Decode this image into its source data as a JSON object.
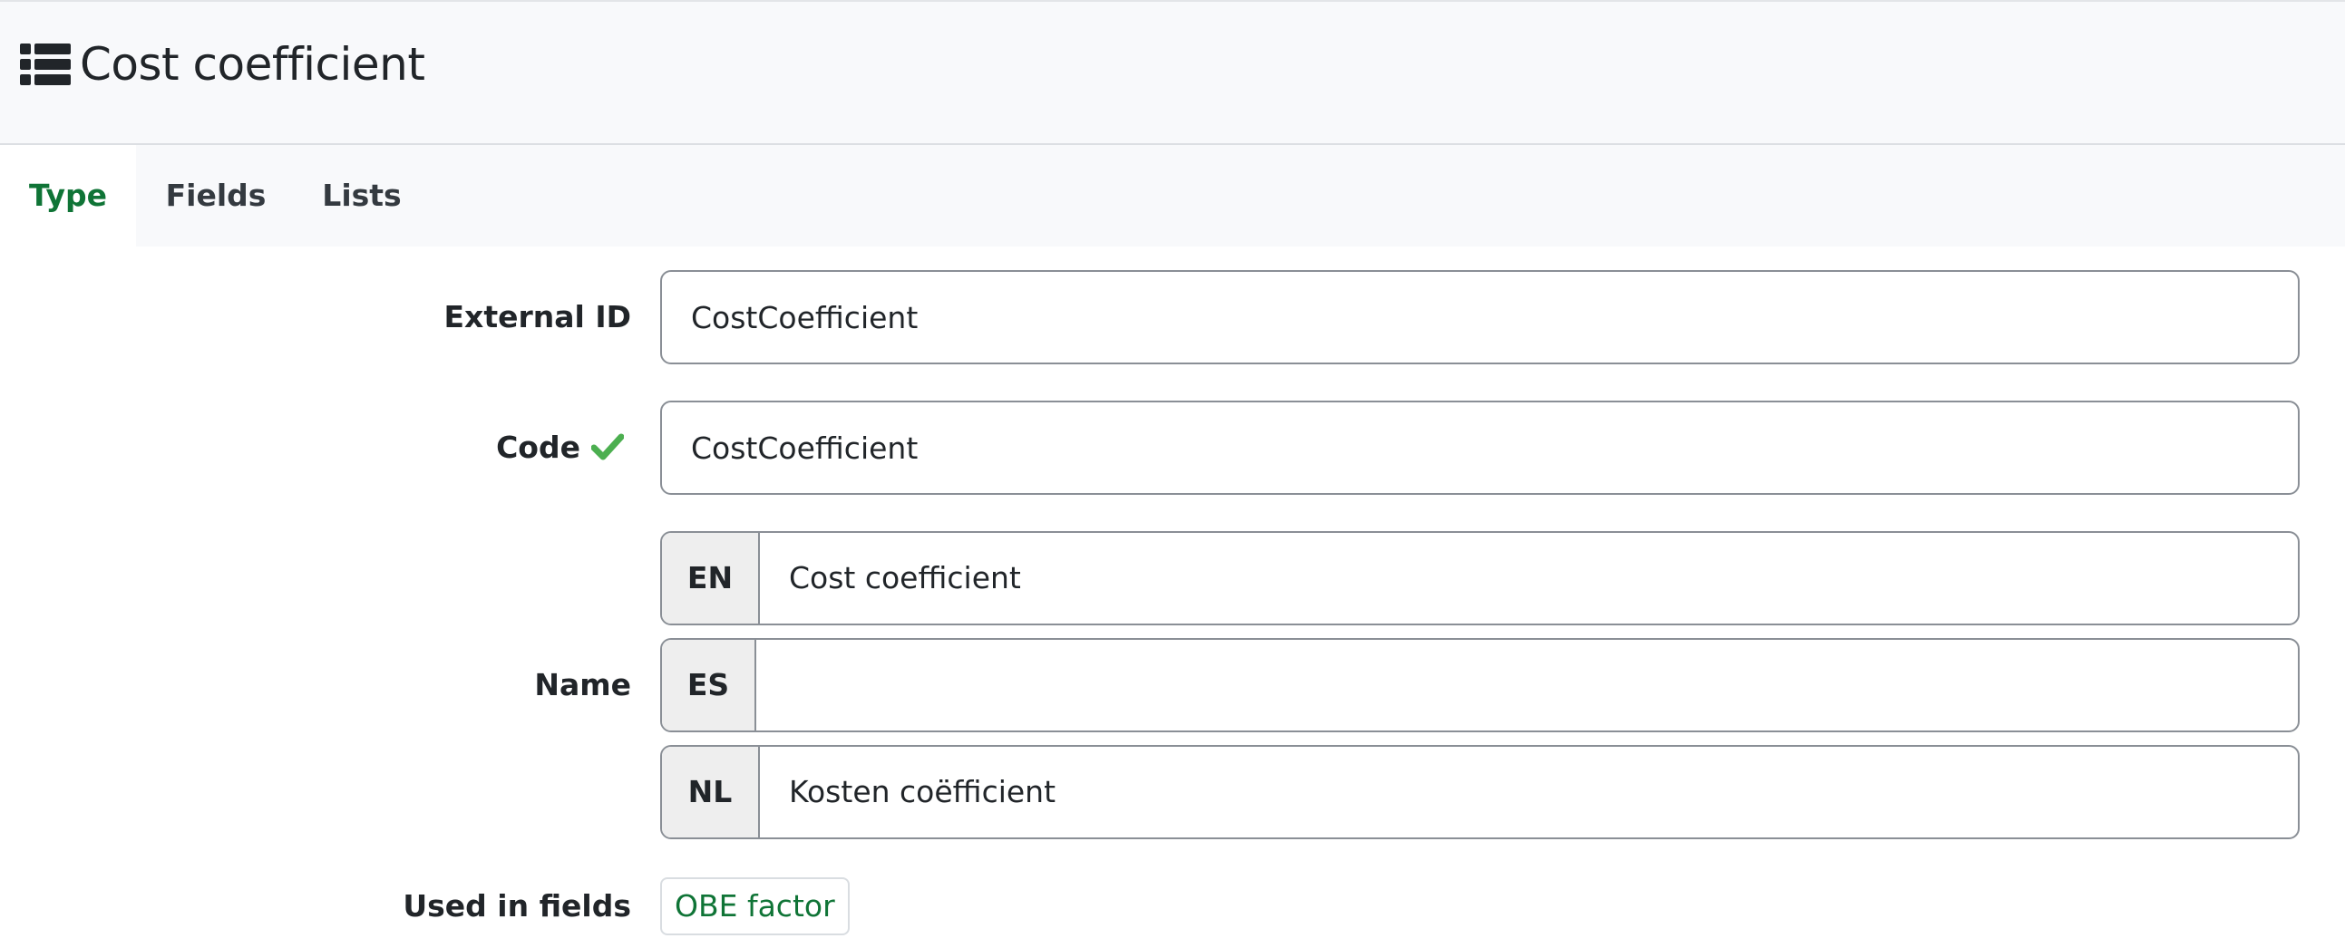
{
  "header": {
    "title": "Cost coefficient",
    "icon": "list-icon"
  },
  "tabs": [
    {
      "label": "Type",
      "active": true
    },
    {
      "label": "Fields",
      "active": false
    },
    {
      "label": "Lists",
      "active": false
    }
  ],
  "form": {
    "external_id": {
      "label": "External ID",
      "value": "CostCoefficient"
    },
    "code": {
      "label": "Code",
      "value": "CostCoefficient",
      "status_icon": "check-icon"
    },
    "name": {
      "label": "Name",
      "translations": [
        {
          "lang": "EN",
          "value": "Cost coefficient"
        },
        {
          "lang": "ES",
          "value": ""
        },
        {
          "lang": "NL",
          "value": "Kosten coëfficient"
        }
      ]
    },
    "used_in_fields": {
      "label": "Used in fields",
      "items": [
        "OBE factor"
      ]
    }
  },
  "colors": {
    "accent_green": "#0f7436",
    "check_green": "#4caf50",
    "header_bg": "#f8f9fb",
    "border": "#8a8f96"
  }
}
